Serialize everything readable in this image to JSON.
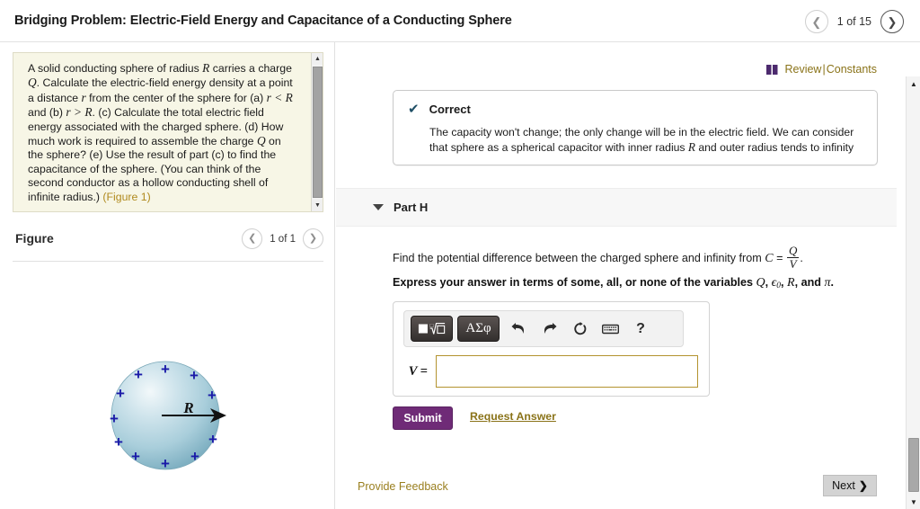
{
  "header": {
    "title": "Bridging Problem: Electric-Field Energy and Capacitance of a Conducting Sphere",
    "prev_icon": "chevron-left-icon",
    "next_icon": "chevron-right-icon",
    "pager_label": "1 of 15"
  },
  "left_panel": {
    "problem_text_parts": {
      "p1": "A solid conducting sphere of radius ",
      "v1": "R",
      "p2": " carries a charge ",
      "v2": "Q",
      "p3": ". Calculate the electric-field energy density at a point a distance ",
      "v3": "r",
      "p4": " from the center of the sphere for (a) ",
      "v4": "r < R",
      "p5": " and (b) ",
      "v5": "r > R",
      "p6": ". (c) Calculate the total electric field energy associated with the charged sphere. (d) How much work is required to assemble the charge ",
      "v6": "Q",
      "p7": " on the sphere? (e) Use the result of part (c) to find the capacitance of the sphere. (You can think of the second conductor as a hollow conducting shell of infinite radius.) ",
      "figure_link": "(Figure 1)"
    },
    "figure": {
      "title": "Figure",
      "pager_label": "1 of 1",
      "prev_icon": "chevron-left-icon",
      "next_icon": "chevron-right-icon",
      "radius_label": "R",
      "charge_symbol": "+",
      "sphere_color": "#a8cdd9",
      "charge_color": "#1a1aa8"
    },
    "scrollbar": {
      "up_icon": "triangle-up-icon",
      "down_icon": "triangle-down-icon"
    }
  },
  "right_panel": {
    "review": {
      "book_icon": "book-icon",
      "review_label": "Review",
      "separator": "|",
      "constants_label": "Constants",
      "color": "#8a7319"
    },
    "correct_box": {
      "check_icon": "check-icon",
      "title": "Correct",
      "body_p1": "The capacity won't change; the only change will be in the electric field. We can consider that sphere as a spherical capacitor with inner radius ",
      "body_v1": "R",
      "body_p2": " and outer radius tends to infinity"
    },
    "part": {
      "caret_icon": "caret-down-icon",
      "label": "Part H",
      "prompt_p1": "Find the potential difference between the charged sphere and infinity from ",
      "prompt_c": "C",
      "prompt_eq": "=",
      "frac_num": "Q",
      "frac_den": "V",
      "prompt_p2": ".",
      "express_p1": "Express your answer in terms of some, all, or none of the variables ",
      "express_v1": "Q",
      "express_c1": ", ",
      "express_v2": "ϵ",
      "express_v2sub": "0",
      "express_c2": ", ",
      "express_v3": "R",
      "express_c3": ", and ",
      "express_v4": "π",
      "express_c4": "."
    },
    "answer": {
      "toolbar": {
        "template_button": {
          "label": "√",
          "icon": "math-template-icon"
        },
        "greek_button": {
          "label": "ΑΣφ",
          "icon": "greek-symbols-icon"
        },
        "undo_icon": "undo-icon",
        "redo_icon": "redo-icon",
        "reset_icon": "reset-icon",
        "keyboard_icon": "keyboard-icon",
        "help_icon": "help-question-icon"
      },
      "variable_label": "V",
      "equals": "=",
      "input_value": "",
      "input_placeholder": "",
      "input_border_color": "#b3932f"
    },
    "submit_label": "Submit",
    "submit_color": "#6f2b77",
    "request_answer_label": "Request Answer",
    "feedback_label": "Provide Feedback",
    "next_label": "Next",
    "next_chevron": "❯",
    "scrollbar": {
      "up_icon": "triangle-up-icon",
      "down_icon": "triangle-down-icon"
    }
  }
}
